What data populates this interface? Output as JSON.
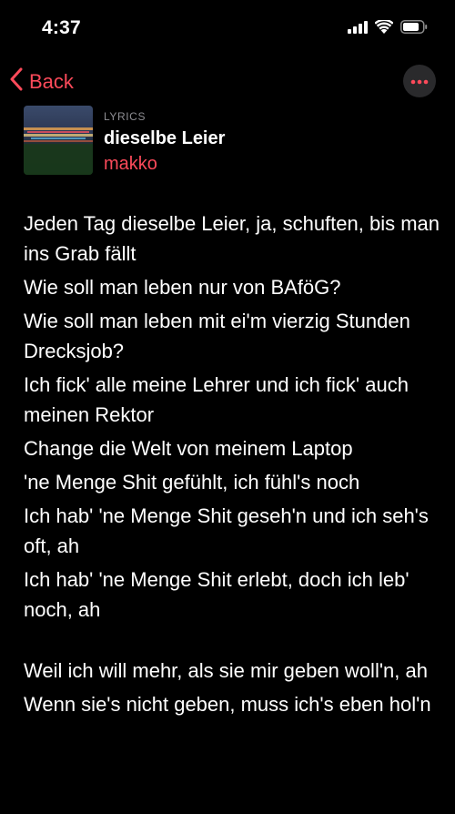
{
  "status_bar": {
    "time": "4:37",
    "icons": [
      "cellular-signal-icon",
      "wifi-icon",
      "battery-icon"
    ]
  },
  "nav": {
    "back_label": "Back",
    "more_icon": "ellipsis-icon"
  },
  "header": {
    "label": "LYRICS",
    "title": "dieselbe Leier",
    "artist": "makko"
  },
  "lyrics": {
    "lines": [
      "Jeden Tag dieselbe Leier, ja, schuften, bis man ins Grab fällt",
      "Wie soll man leben nur von BAföG?",
      "Wie soll man leben mit ei'm vierzig Stunden Drecksjob?",
      "Ich fick' alle meine Lehrer und ich fick' auch meinen Rektor",
      "Change die Welt von meinem Laptop",
      "'ne Menge Shit gefühlt, ich fühl's noch",
      "Ich hab' 'ne Menge Shit geseh'n und ich seh's oft, ah",
      "Ich hab' 'ne Menge Shit erlebt, doch ich leb' noch, ah",
      "Weil ich will mehr, als sie mir geben woll'n, ah",
      "Wenn sie's nicht geben, muss ich's eben hol'n"
    ]
  },
  "colors": {
    "accent": "#fc4a5a",
    "background": "#000000",
    "secondary_text": "#8e8e93"
  }
}
